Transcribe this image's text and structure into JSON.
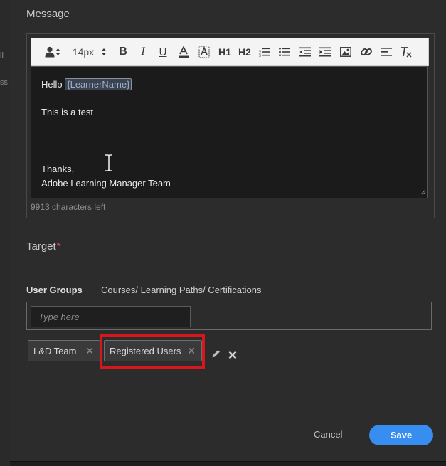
{
  "backdrop": {
    "fragments": [
      "il",
      "ss."
    ]
  },
  "message": {
    "section_label": "Message",
    "toolbar": {
      "font_size": "14px",
      "heading1": "H1",
      "heading2": "H2",
      "bold": "B",
      "italic": "I",
      "underline": "U",
      "font_color": "A"
    },
    "body": {
      "greeting": "Hello",
      "token": "{LearnerName}",
      "line2": "This is a test",
      "line3": "Thanks,",
      "line4": "Adobe Learning Manager Team"
    },
    "chars_left": "9913 characters left"
  },
  "target": {
    "section_label": "Target",
    "required_marker": "*",
    "tabs": [
      "User Groups",
      "Courses/ Learning Paths/ Certifications"
    ],
    "search_placeholder": "Type here",
    "chips": [
      "L&D Team",
      "Registered Users"
    ],
    "chip_remove_glyph": "✕"
  },
  "footer": {
    "cancel_label": "Cancel",
    "save_label": "Save"
  },
  "colors": {
    "accent": "#378ef0",
    "highlight": "#d7161e",
    "dialog_bg": "#2c2c2c",
    "editor_bg": "#1b1b1b",
    "required": "#e34850"
  }
}
